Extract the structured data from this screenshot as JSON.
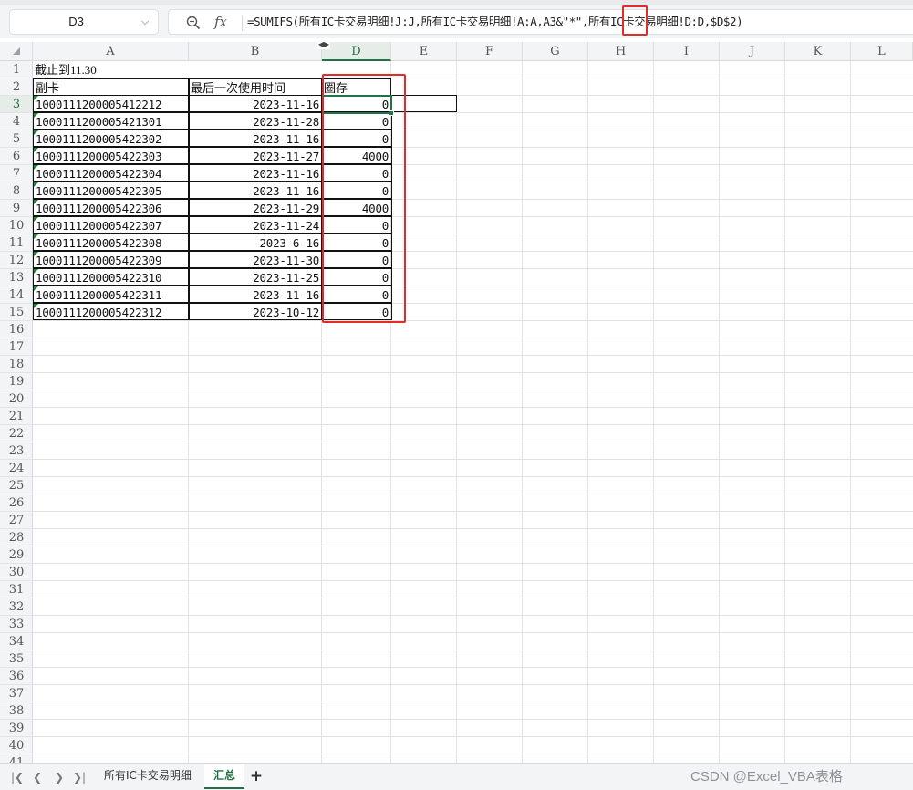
{
  "name_box": "D3",
  "formula": "=SUMIFS(所有IC卡交易明细!J:J,所有IC卡交易明细!A:A,A3&\"*\",所有IC卡交易明细!D:D,$D$2)",
  "column_headers": [
    "A",
    "B",
    "D",
    "E",
    "F",
    "G",
    "H",
    "I",
    "J",
    "K",
    "L"
  ],
  "row_numbers": [
    "1",
    "2",
    "3",
    "4",
    "5",
    "6",
    "7",
    "8",
    "9",
    "10",
    "11",
    "12",
    "13",
    "14",
    "15",
    "16",
    "17",
    "18",
    "19",
    "20",
    "21",
    "22",
    "23",
    "24",
    "25",
    "26",
    "27",
    "28",
    "29",
    "30",
    "31",
    "32",
    "33",
    "34",
    "35",
    "36",
    "37",
    "38",
    "39",
    "40",
    "41"
  ],
  "cells": {
    "a1": "截止到11.30",
    "headers": [
      "副卡",
      "最后一次使用时间",
      "圈存"
    ]
  },
  "rows": [
    {
      "card": "1000111200005412212",
      "date": "2023-11-16",
      "amount": "0"
    },
    {
      "card": "1000111200005421301",
      "date": "2023-11-28",
      "amount": "0"
    },
    {
      "card": "1000111200005422302",
      "date": "2023-11-16",
      "amount": "0"
    },
    {
      "card": "1000111200005422303",
      "date": "2023-11-27",
      "amount": "4000"
    },
    {
      "card": "1000111200005422304",
      "date": "2023-11-16",
      "amount": "0"
    },
    {
      "card": "1000111200005422305",
      "date": "2023-11-16",
      "amount": "0"
    },
    {
      "card": "1000111200005422306",
      "date": "2023-11-29",
      "amount": "4000"
    },
    {
      "card": "1000111200005422307",
      "date": "2023-11-24",
      "amount": "0"
    },
    {
      "card": "1000111200005422308",
      "date": "2023-6-16",
      "amount": "0"
    },
    {
      "card": "1000111200005422309",
      "date": "2023-11-30",
      "amount": "0"
    },
    {
      "card": "1000111200005422310",
      "date": "2023-11-25",
      "amount": "0"
    },
    {
      "card": "1000111200005422311",
      "date": "2023-11-16",
      "amount": "0"
    },
    {
      "card": "1000111200005422312",
      "date": "2023-10-12",
      "amount": "0"
    }
  ],
  "sheet_tabs": [
    "所有IC卡交易明细",
    "汇总"
  ],
  "active_sheet": "汇总",
  "watermark": "CSDN @Excel_VBA表格"
}
